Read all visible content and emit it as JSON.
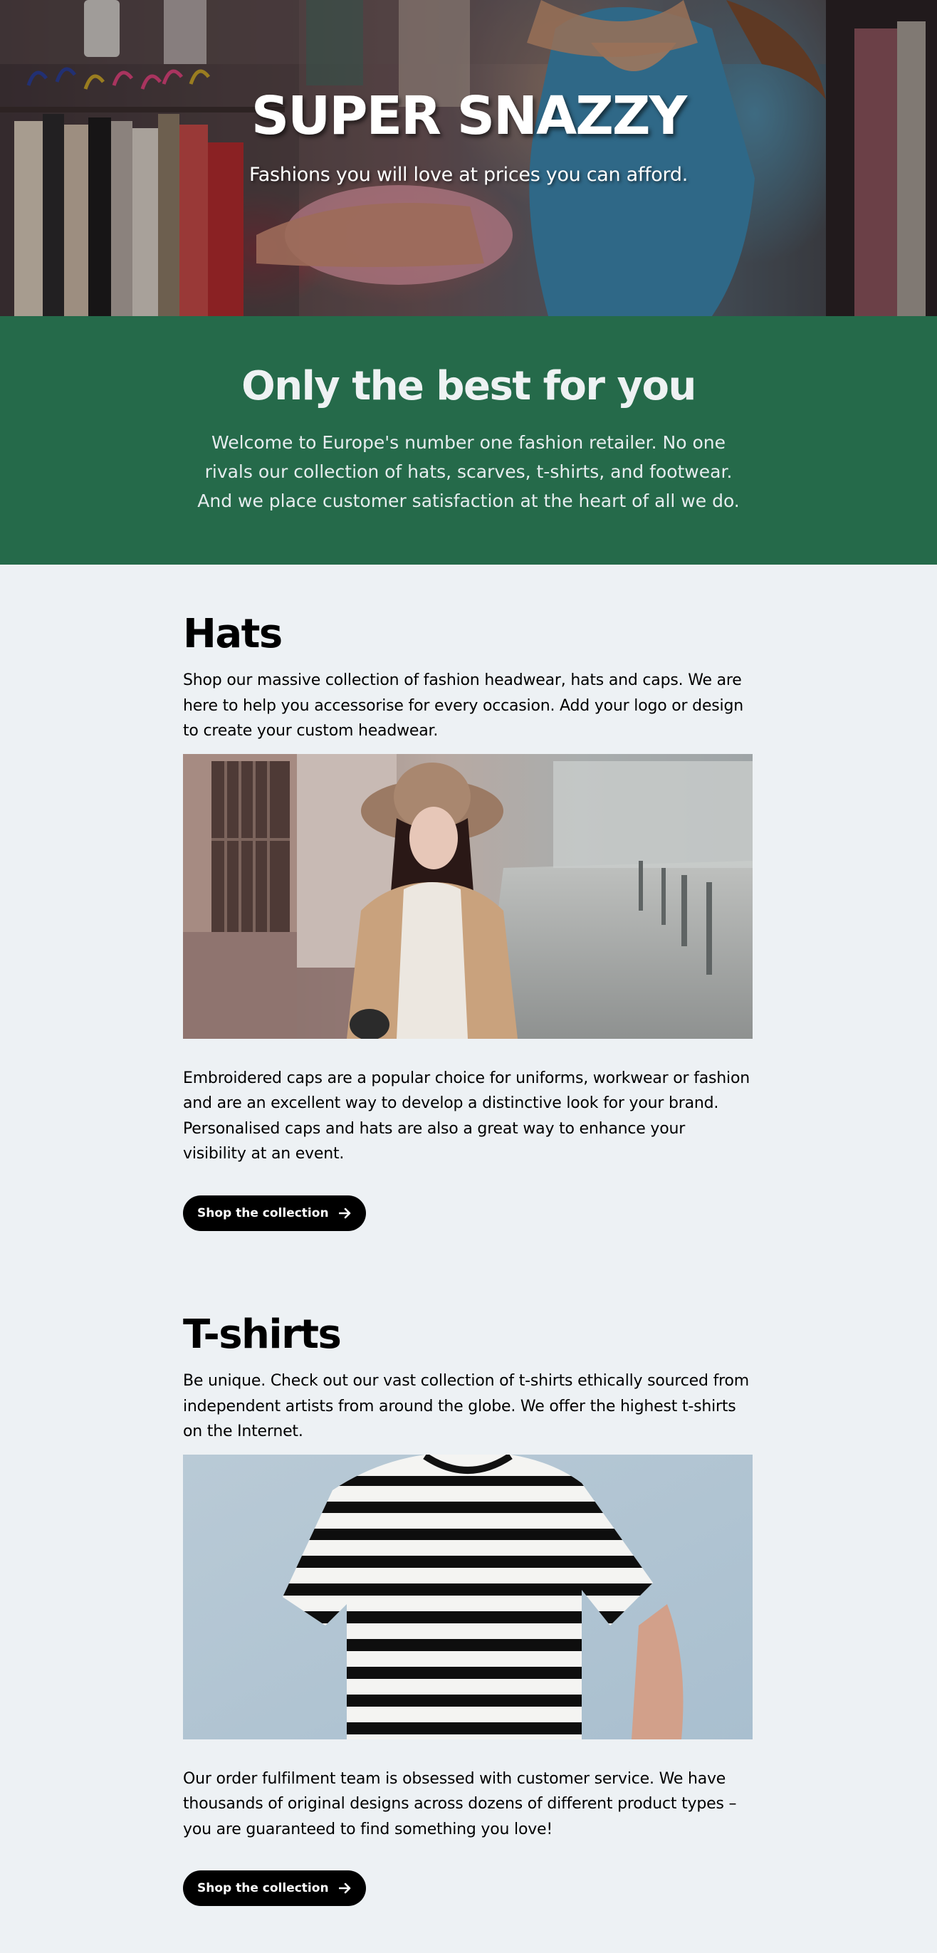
{
  "hero": {
    "title": "SUPER SNAZZY",
    "subtitle": "Fashions you will love at prices you can afford."
  },
  "intro": {
    "heading": "Only the best for you",
    "text": "Welcome to Europe's number one fashion retailer. No one rivals our collection of hats, scarves, t-shirts, and footwear. And we place customer satisfaction at the heart of all we do."
  },
  "sections": [
    {
      "heading": "Hats",
      "lead": "Shop our massive collection of fashion headwear, hats and caps. We are here to help you accessorise for every occasion. Add your logo or design to create your custom headwear.",
      "body": "Embroidered caps are a popular choice for uniforms, workwear or fashion and are an excellent way to develop a distinctive look for your brand. Personalised caps and hats are also a great way to enhance your visibility at an event.",
      "cta_label": "Shop the collection",
      "cta_icon": "arrow-right-icon"
    },
    {
      "heading": "T-shirts",
      "lead": "Be unique. Check out our vast collection of t-shirts ethically sourced from independent artists from around the globe. We offer the highest t-shirts on the Internet.",
      "body": "Our order fulfilment team is obsessed with customer service. We have thousands of original designs across dozens of different product types – you are guaranteed to find something you love!",
      "cta_label": "Shop the collection",
      "cta_icon": "arrow-right-icon"
    }
  ],
  "colors": {
    "page_background": "#edf1f4",
    "intro_band": "#256a4a",
    "button": "#000000",
    "button_text": "#ffffff"
  }
}
